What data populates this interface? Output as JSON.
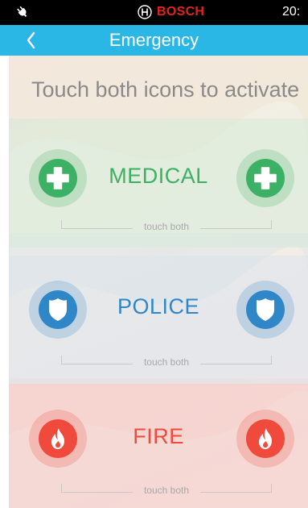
{
  "status_bar": {
    "brand": "BOSCH",
    "time": "20:",
    "plug_icon": "plug-icon",
    "brand_icon": "bosch-logo-icon"
  },
  "nav": {
    "title": "Emergency",
    "back_icon": "chevron-left-icon"
  },
  "instruction": "Touch both icons to activate",
  "sections": [
    {
      "id": "medical",
      "label": "MEDICAL",
      "hint": "touch both",
      "icon": "medical-cross-icon",
      "color": "#3cb064"
    },
    {
      "id": "police",
      "label": "POLICE",
      "hint": "touch both",
      "icon": "shield-icon",
      "color": "#2f87c7"
    },
    {
      "id": "fire",
      "label": "FIRE",
      "hint": "touch both",
      "icon": "flame-icon",
      "color": "#f04a3d"
    }
  ],
  "colors": {
    "nav_bar": "#2bb7e6",
    "status_bar": "#000000",
    "brand_red": "#e2231a"
  }
}
